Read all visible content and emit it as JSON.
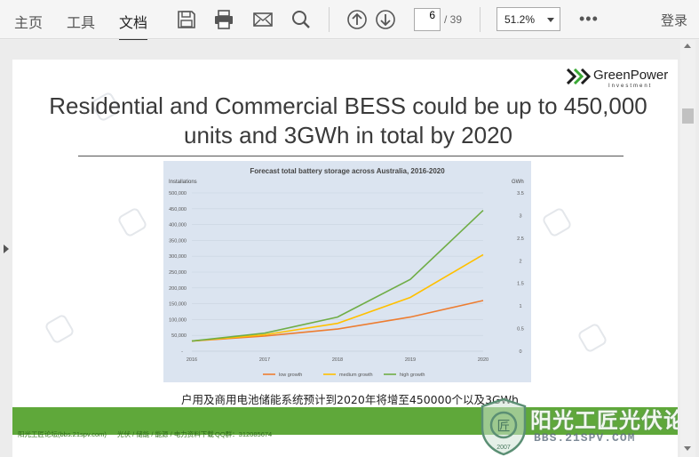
{
  "toolbar": {
    "tabs": [
      "主页",
      "工具",
      "文档"
    ],
    "active_tab": "文档",
    "page_current": "6",
    "page_total": "/ 39",
    "zoom": "51.2%",
    "more": "•••",
    "login": "登录",
    "icons": [
      "save-icon",
      "print-icon",
      "mail-icon",
      "search-icon",
      "page-up-icon",
      "page-down-icon"
    ]
  },
  "slide": {
    "logo_name": "GreenPower",
    "logo_sub": "Investment",
    "title": "Residential and Commercial BESS could be up to 450,000 units and 3GWh in total by 2020",
    "caption": "户用及商用电池储能系统预计到2020年将增至450000个以及3GWh",
    "footer": [
      "阳光工匠论坛(bbs.21spv.com)",
      "光伏 / 储能 / 能源 / 电力资料下载",
      "QQ群：312085674"
    ],
    "watermark_name": "阳光工匠光伏论坛",
    "watermark_url": "BBS.21SPV.COM",
    "watermark_year": "2007",
    "colors": {
      "footer_green": "#5fa83a",
      "chart_bg": "#dbe4f0"
    }
  },
  "chart_data": {
    "type": "line",
    "title": "Forecast total battery storage across Australia, 2016-2020",
    "ylabel": "Installations",
    "y2label": "GWh",
    "x": [
      "2016",
      "2017",
      "2018",
      "2019",
      "2020"
    ],
    "ylim": [
      0,
      500000
    ],
    "y2lim": [
      0,
      3.5
    ],
    "yticks": [
      "50,000",
      "100,000",
      "150,000",
      "200,000",
      "250,000",
      "300,000",
      "350,000",
      "400,000",
      "450,000",
      "500,000"
    ],
    "y2ticks": [
      "0",
      "0.5",
      "1",
      "1.5",
      "2",
      "2.5",
      "3",
      "3.5"
    ],
    "series": [
      {
        "name": "low growth",
        "color": "#ed7d31",
        "values": [
          32000,
          48000,
          70000,
          108000,
          160000
        ]
      },
      {
        "name": "medium growth",
        "color": "#ffc000",
        "values": [
          32000,
          52000,
          88000,
          170000,
          305000
        ]
      },
      {
        "name": "high growth",
        "color": "#70ad47",
        "values": [
          32000,
          57000,
          108000,
          227000,
          445000
        ]
      }
    ],
    "legend": "bottom",
    "grid": true
  }
}
